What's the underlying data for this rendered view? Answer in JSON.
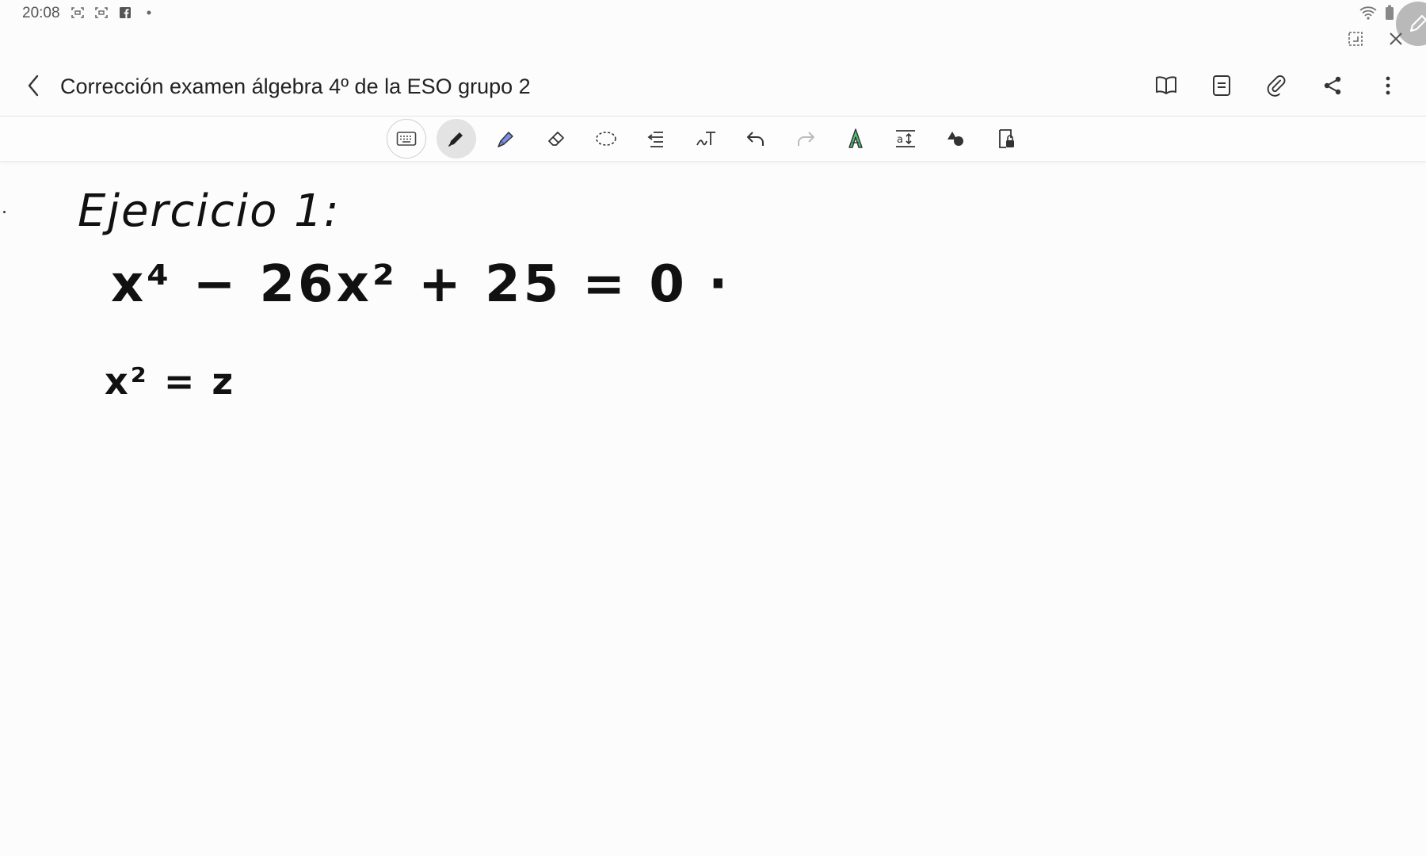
{
  "status_bar": {
    "time": "20:08",
    "left_icons": [
      "screen-record-icon",
      "screen-record-icon",
      "facebook-icon",
      "dot-icon"
    ],
    "right_icons": [
      "wifi-icon",
      "battery-icon",
      "pen-icon"
    ]
  },
  "window_controls": [
    "resize-icon",
    "close-icon"
  ],
  "header": {
    "title": "Corrección examen álgebra 4º de la ESO grupo 2",
    "actions": [
      "book-view-icon",
      "page-view-icon",
      "attach-icon",
      "share-icon",
      "more-icon"
    ]
  },
  "toolbar": {
    "tools": [
      "keyboard",
      "pen",
      "highlighter",
      "eraser",
      "lasso",
      "text-format",
      "handwriting-to-text",
      "undo",
      "redo",
      "pen-color",
      "text-size",
      "shapes",
      "read-only"
    ],
    "selected_tool": "pen"
  },
  "canvas": {
    "heading": "Ejercicio 1:",
    "equation1": "x⁴ − 26x² + 25 = 0 ·",
    "equation2": "x² = z"
  },
  "colors": {
    "ink": "#111111",
    "highlighter": "#7b8fe8",
    "pen_color_green": "#4cc27a"
  }
}
